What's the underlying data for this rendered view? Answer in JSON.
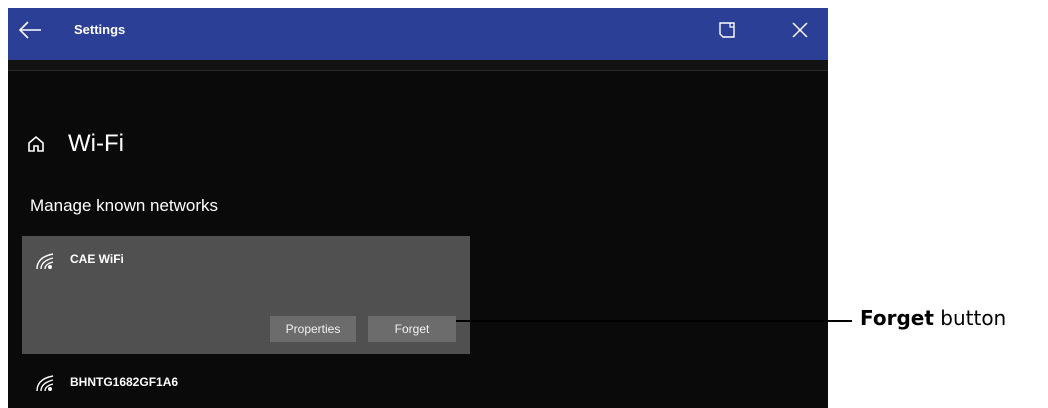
{
  "window": {
    "title": "Settings",
    "titlebar_color": "#2b3f96",
    "icons": {
      "back": "arrow-left-icon",
      "snap": "snap-window-icon",
      "close": "close-icon",
      "home": "home-icon",
      "wifi": "wifi-signal-icon"
    }
  },
  "page": {
    "title": "Wi-Fi",
    "section_title": "Manage known networks"
  },
  "networks": [
    {
      "name": "CAE WiFi",
      "selected": true,
      "buttons": {
        "properties": "Properties",
        "forget": "Forget"
      }
    },
    {
      "name": "BHNTG1682GF1A6",
      "selected": false
    }
  ],
  "annotation": {
    "bold": "Forget",
    "rest": " button"
  }
}
